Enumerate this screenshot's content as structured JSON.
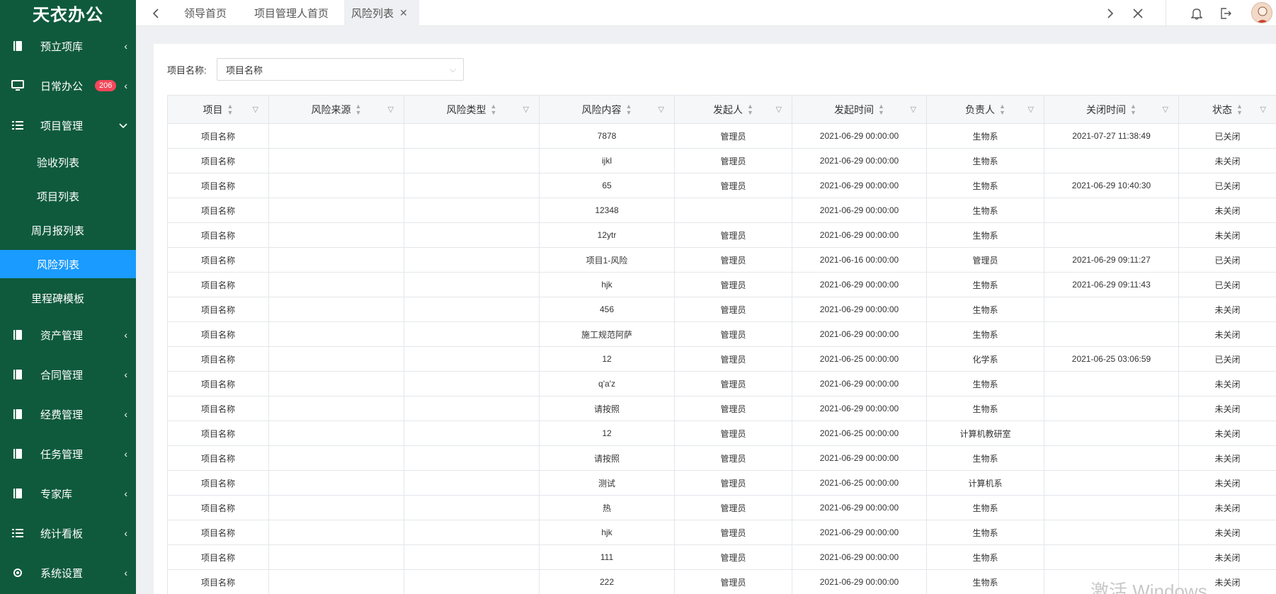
{
  "app": {
    "title": "天衣办公"
  },
  "sidebar": {
    "items": [
      {
        "label": "预立项库",
        "icon": "book-icon",
        "caret": "‹"
      },
      {
        "label": "日常办公",
        "icon": "monitor-icon",
        "badge": "206",
        "caret": "‹"
      },
      {
        "label": "项目管理",
        "icon": "list-icon",
        "caret": "⌄"
      },
      {
        "label": "资产管理",
        "icon": "book-icon",
        "caret": "‹"
      },
      {
        "label": "合同管理",
        "icon": "book-icon",
        "caret": "‹"
      },
      {
        "label": "经费管理",
        "icon": "book-icon",
        "caret": "‹"
      },
      {
        "label": "任务管理",
        "icon": "book-icon",
        "caret": "‹"
      },
      {
        "label": "专家库",
        "icon": "book-icon",
        "caret": "‹"
      },
      {
        "label": "统计看板",
        "icon": "list-icon",
        "caret": "‹"
      },
      {
        "label": "系统设置",
        "icon": "gear-icon",
        "caret": "‹"
      }
    ],
    "subitems": [
      {
        "label": "验收列表"
      },
      {
        "label": "项目列表"
      },
      {
        "label": "周月报列表"
      },
      {
        "label": "风险列表",
        "active": true
      },
      {
        "label": "里程碑模板"
      }
    ]
  },
  "tabs": [
    {
      "label": "领导首页"
    },
    {
      "label": "项目管理人首页"
    },
    {
      "label": "风险列表",
      "active": true
    }
  ],
  "filter": {
    "label": "项目名称:",
    "value": "项目名称"
  },
  "table": {
    "columns": [
      "项目",
      "风险来源",
      "风险类型",
      "风险内容",
      "发起人",
      "发起时间",
      "负责人",
      "关闭时间",
      "状态"
    ],
    "rows": [
      [
        "项目名称",
        "",
        "",
        "7878",
        "管理员",
        "2021-06-29 00:00:00",
        "生物系",
        "2021-07-27 11:38:49",
        "已关闭"
      ],
      [
        "项目名称",
        "",
        "",
        "ijkl",
        "管理员",
        "2021-06-29 00:00:00",
        "生物系",
        "",
        "未关闭"
      ],
      [
        "项目名称",
        "",
        "",
        "65",
        "管理员",
        "2021-06-29 00:00:00",
        "生物系",
        "2021-06-29 10:40:30",
        "已关闭"
      ],
      [
        "项目名称",
        "",
        "",
        "12348",
        "",
        "2021-06-29 00:00:00",
        "生物系",
        "",
        "未关闭"
      ],
      [
        "项目名称",
        "",
        "",
        "12ytr",
        "管理员",
        "2021-06-29 00:00:00",
        "生物系",
        "",
        "未关闭"
      ],
      [
        "项目名称",
        "",
        "",
        "项目1-风险",
        "管理员",
        "2021-06-16 00:00:00",
        "管理员",
        "2021-06-29 09:11:27",
        "已关闭"
      ],
      [
        "项目名称",
        "",
        "",
        "hjk",
        "管理员",
        "2021-06-29 00:00:00",
        "生物系",
        "2021-06-29 09:11:43",
        "已关闭"
      ],
      [
        "项目名称",
        "",
        "",
        "456",
        "管理员",
        "2021-06-29 00:00:00",
        "生物系",
        "",
        "未关闭"
      ],
      [
        "项目名称",
        "",
        "",
        "施工规范阿萨",
        "管理员",
        "2021-06-29 00:00:00",
        "生物系",
        "",
        "未关闭"
      ],
      [
        "项目名称",
        "",
        "",
        "12",
        "管理员",
        "2021-06-25 00:00:00",
        "化学系",
        "2021-06-25 03:06:59",
        "已关闭"
      ],
      [
        "项目名称",
        "",
        "",
        "q'a'z",
        "管理员",
        "2021-06-29 00:00:00",
        "生物系",
        "",
        "未关闭"
      ],
      [
        "项目名称",
        "",
        "",
        "请按照",
        "管理员",
        "2021-06-29 00:00:00",
        "生物系",
        "",
        "未关闭"
      ],
      [
        "项目名称",
        "",
        "",
        "12",
        "管理员",
        "2021-06-25 00:00:00",
        "计算机教研室",
        "",
        "未关闭"
      ],
      [
        "项目名称",
        "",
        "",
        "请按照",
        "管理员",
        "2021-06-29 00:00:00",
        "生物系",
        "",
        "未关闭"
      ],
      [
        "项目名称",
        "",
        "",
        "测试",
        "管理员",
        "2021-06-25 00:00:00",
        "计算机系",
        "",
        "未关闭"
      ],
      [
        "项目名称",
        "",
        "",
        "热",
        "管理员",
        "2021-06-29 00:00:00",
        "生物系",
        "",
        "未关闭"
      ],
      [
        "项目名称",
        "",
        "",
        "hjk",
        "管理员",
        "2021-06-29 00:00:00",
        "生物系",
        "",
        "未关闭"
      ],
      [
        "项目名称",
        "",
        "",
        "111",
        "管理员",
        "2021-06-29 00:00:00",
        "生物系",
        "",
        "未关闭"
      ],
      [
        "项目名称",
        "",
        "",
        "222",
        "管理员",
        "2021-06-29 00:00:00",
        "生物系",
        "",
        "未关闭"
      ]
    ]
  },
  "watermark": "激活 Windows",
  "colors": {
    "sidebar": "#0f5a3d",
    "active": "#1a9bff",
    "badge": "#f5475a"
  }
}
